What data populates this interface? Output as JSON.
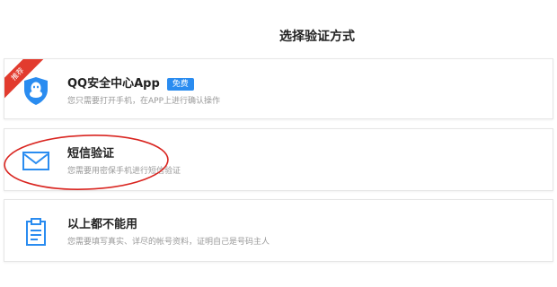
{
  "page": {
    "title": "选择验证方式"
  },
  "options": [
    {
      "title": "QQ安全中心App",
      "badge": "免费",
      "ribbon": "推荐",
      "desc": "您只需要打开手机，在APP上进行确认操作",
      "icon": "qq-shield-icon"
    },
    {
      "title": "短信验证",
      "desc": "您需要用密保手机进行短信验证",
      "icon": "envelope-icon"
    },
    {
      "title": "以上都不能用",
      "desc": "您需要填写真实、详尽的帐号资料，证明自己是号码主人",
      "icon": "clipboard-icon"
    }
  ],
  "colors": {
    "accent_blue": "#2a8cf0",
    "ribbon_red": "#e23b2e",
    "annotation_red": "#d9241f"
  }
}
